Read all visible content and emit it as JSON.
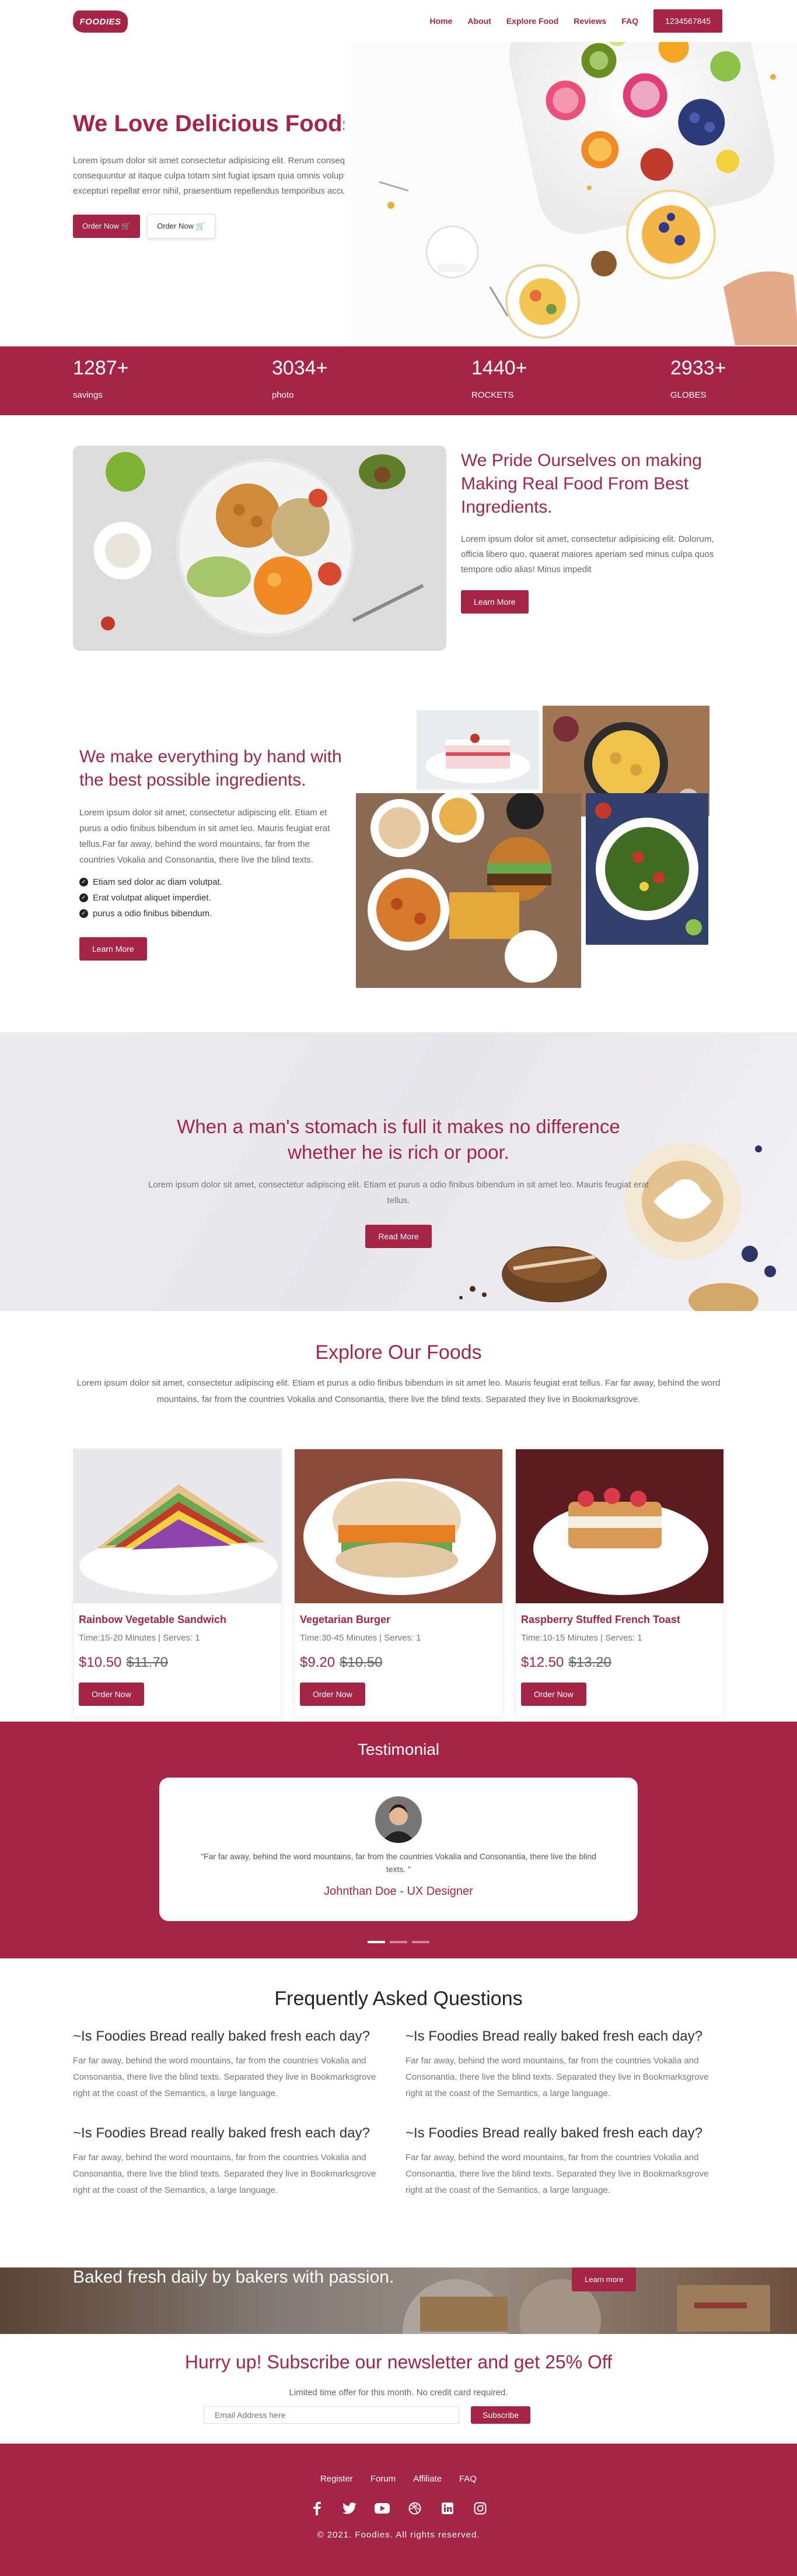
{
  "header": {
    "logo": "FOODIES",
    "nav": [
      "Home",
      "About",
      "Explore Food",
      "Reviews",
      "FAQ"
    ],
    "phone": "1234567845"
  },
  "hero": {
    "title": "We Love Delicious Foods!",
    "text": "Lorem ipsum dolor sit amet consectetur adipisicing elit. Rerum consequatur, ut consequuntur at itaque culpa totam sint fugiat ipsam quia omnis voluptas, excepturi repellat error nihil, praesentium repellendus temporibus accusamus.",
    "order_primary": "Order Now",
    "order_secondary": "Order Now"
  },
  "stats": [
    {
      "value": "1287+",
      "label": "savings"
    },
    {
      "value": "3034+",
      "label": "photo"
    },
    {
      "value": "1440+",
      "label": "ROCKETS"
    },
    {
      "value": "2933+",
      "label": "GLOBES"
    }
  ],
  "pride": {
    "title": "We Pride Ourselves on making Making Real Food From Best Ingredients.",
    "text": "Lorem ipsum dolor sit amet, consectetur adipisicing elit. Dolorum, officia libero quo, quaerat maiores aperiam sed minus culpa quos tempore odio alias! Minus impedit",
    "button": "Learn More"
  },
  "handmade": {
    "title": "We make everything by hand with the best possible ingredients.",
    "text": "Lorem ipsum dolor sit amet, consectetur adipiscing elit. Etiam et purus a odio finibus bibendum in sit amet leo. Mauris feugiat erat tellus.Far far away, behind the word mountains, far from the countries Vokalia and Consonantia, there live the blind texts.",
    "list": [
      "Etiam sed dolor ac diam volutpat.",
      "Erat volutpat aliquet imperdiet.",
      "purus a odio finibus bibendum."
    ],
    "button": "Learn More"
  },
  "quote": {
    "title": "When a man's stomach is full it makes no difference whether he is rich or poor.",
    "text": "Lorem ipsum dolor sit amet, consectetur adipiscing elit. Etiam et purus a odio finibus bibendum in sit amet leo. Mauris feugiat erat tellus.",
    "button": "Read More"
  },
  "explore": {
    "title": "Explore Our Foods",
    "text": "Lorem ipsum dolor sit amet, consectetur adipiscing elit. Etiam et purus a odio finibus bibendum in sit amet leo. Mauris feugiat erat tellus. Far far away, behind the word mountains, far from the countries Vokalia and Consonantia, there live the blind texts. Separated they live in Bookmarksgrove.",
    "items": [
      {
        "name": "Rainbow Vegetable Sandwich",
        "meta": "Time:15-20 Minutes | Serves: 1",
        "price": "$10.50",
        "old_price": "$11.70",
        "button": "Order Now"
      },
      {
        "name": "Vegetarian Burger",
        "meta": "Time:30-45 Minutes | Serves: 1",
        "price": "$9.20",
        "old_price": "$10.50",
        "button": "Order Now"
      },
      {
        "name": "Raspberry Stuffed French Toast",
        "meta": "Time:10-15 Minutes | Serves: 1",
        "price": "$12.50",
        "old_price": "$13.20",
        "button": "Order Now"
      }
    ]
  },
  "testimonial": {
    "title": "Testimonial",
    "quote": "\"Far far away, behind the word mountains, far from the countries Vokalia and Consonantia, there live the blind texts. \"",
    "author": "Johnthan Doe - UX Designer",
    "slide_count": 3,
    "active_slide": 1
  },
  "faq": {
    "title": "Frequently Asked Questions",
    "items": [
      {
        "q": "~Is Foodies Bread really baked fresh each day?",
        "a": "Far far away, behind the word mountains, far from the countries Vokalia and Consonantia, there live the blind texts. Separated they live in Bookmarksgrove right at the coast of the Semantics, a large language."
      },
      {
        "q": "~Is Foodies Bread really baked fresh each day?",
        "a": "Far far away, behind the word mountains, far from the countries Vokalia and Consonantia, there live the blind texts. Separated they live in Bookmarksgrove right at the coast of the Semantics, a large language."
      },
      {
        "q": "~Is Foodies Bread really baked fresh each day?",
        "a": "Far far away, behind the word mountains, far from the countries Vokalia and Consonantia, there live the blind texts. Separated they live in Bookmarksgrove right at the coast of the Semantics, a large language."
      },
      {
        "q": "~Is Foodies Bread really baked fresh each day?",
        "a": "Far far away, behind the word mountains, far from the countries Vokalia and Consonantia, there live the blind texts. Separated they live in Bookmarksgrove right at the coast of the Semantics, a large language."
      }
    ]
  },
  "bread": {
    "title": "Baked fresh daily by bakers with passion.",
    "button": "Learn more"
  },
  "subscribe": {
    "title": "Hurry up! Subscribe our newsletter and get 25% Off",
    "text": "Limited time offer for this month. No credit card required.",
    "placeholder": "Email Address here",
    "button": "Subscribe"
  },
  "footer": {
    "links": [
      "Register",
      "Forum",
      "Affiliate",
      "FAQ"
    ],
    "social": [
      "facebook-icon",
      "twitter-icon",
      "youtube-icon",
      "dribbble-icon",
      "linkedin-icon",
      "instagram-icon"
    ],
    "copyright": "© 2021. Foodies. All rights reserved."
  },
  "colors": {
    "brand": "#a62547"
  }
}
